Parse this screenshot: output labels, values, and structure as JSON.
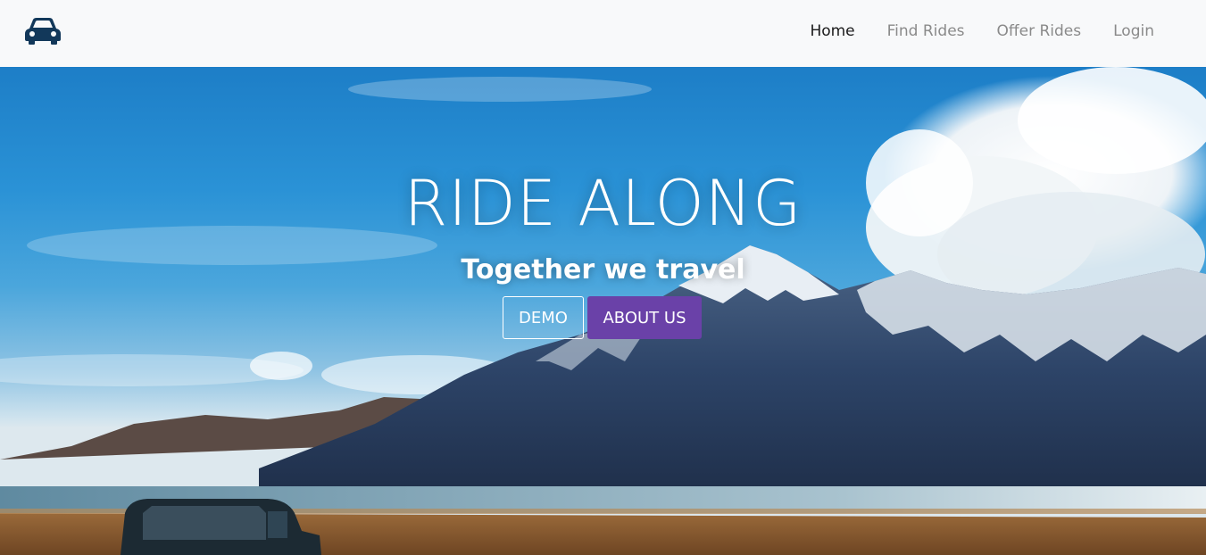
{
  "navbar": {
    "brand_icon": "car-icon",
    "brand_color": "#12385a",
    "links": [
      {
        "label": "Home",
        "active": true
      },
      {
        "label": "Find Rides",
        "active": false
      },
      {
        "label": "Offer Rides",
        "active": false
      },
      {
        "label": "Login",
        "active": false
      }
    ]
  },
  "hero": {
    "title": "RIDE ALONG",
    "subtitle": "Together we travel",
    "buttons": {
      "demo_label": "DEMO",
      "about_label": "ABOUT US"
    },
    "accent_color": "#6a41a8"
  }
}
